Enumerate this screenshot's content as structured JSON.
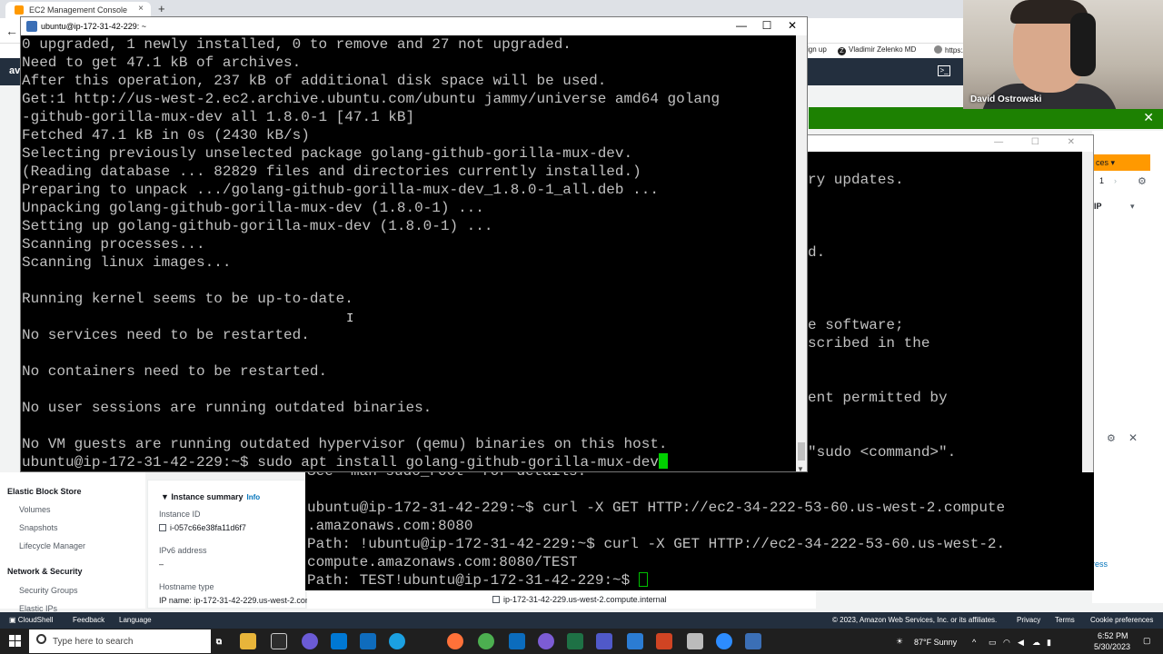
{
  "browser": {
    "tab_title": "EC2 Management Console",
    "tab_close": "×",
    "new_tab": "+",
    "back": "←",
    "bookmarks": [
      "ign up",
      "Vladimir Zelenko MD",
      "https://"
    ]
  },
  "aws": {
    "logo_partial": "av",
    "sidebar": {
      "group_ebs": "Elastic Block Store",
      "ebs_items": [
        "Volumes",
        "Snapshots",
        "Lifecycle Manager"
      ],
      "group_network": "Network & Security",
      "network_items": [
        "Security Groups",
        "Elastic IPs"
      ]
    },
    "summary": {
      "title": "Instance summary",
      "info": "Info",
      "instance_id_label": "Instance ID",
      "instance_id": "i-057c66e38fa11d6f7",
      "ipv6_label": "IPv6 address",
      "ipv6_value": "–",
      "hostname_label": "Hostname type",
      "ip_name": "IP name: ip-172-31-42-229.us-west-2.compute.internal",
      "private_dns": "ip-172-31-42-229.us-west-2.compute.internal"
    },
    "right_panel": {
      "actions": "ces",
      "page": "1",
      "ip_col": "IP",
      "ress": "ress"
    },
    "footer": {
      "cloudshell": "CloudShell",
      "feedback": "Feedback",
      "language": "Language",
      "copyright": "© 2023, Amazon Web Services, Inc. or its affiliates.",
      "privacy": "Privacy",
      "terms": "Terms",
      "cookies": "Cookie preferences"
    }
  },
  "front_terminal": {
    "title": "ubuntu@ip-172-31-42-229: ~",
    "controls": {
      "minimize": "—",
      "maximize": "☐",
      "close": "✕"
    },
    "lines": [
      "0 upgraded, 1 newly installed, 0 to remove and 27 not upgraded.",
      "Need to get 47.1 kB of archives.",
      "After this operation, 237 kB of additional disk space will be used.",
      "Get:1 http://us-west-2.ec2.archive.ubuntu.com/ubuntu jammy/universe amd64 golang",
      "-github-gorilla-mux-dev all 1.8.0-1 [47.1 kB]",
      "Fetched 47.1 kB in 0s (2430 kB/s)",
      "Selecting previously unselected package golang-github-gorilla-mux-dev.",
      "(Reading database ... 82829 files and directories currently installed.)",
      "Preparing to unpack .../golang-github-gorilla-mux-dev_1.8.0-1_all.deb ...",
      "Unpacking golang-github-gorilla-mux-dev (1.8.0-1) ...",
      "Setting up golang-github-gorilla-mux-dev (1.8.0-1) ...",
      "Scanning processes...",
      "Scanning linux images...",
      "",
      "Running kernel seems to be up-to-date.",
      "",
      "No services need to be restarted.",
      "",
      "No containers need to be restarted.",
      "",
      "No user sessions are running outdated binaries.",
      "",
      "No VM guests are running outdated hypervisor (qemu) binaries on this host.",
      "ubuntu@ip-172-31-42-229:~$ sudo apt install golang-github-gorilla-mux-dev"
    ]
  },
  "back_terminal": {
    "controls": "— ☐ ✕",
    "lines": [
      {
        "text": "ry updates.",
        "row": 0
      },
      {
        "text": "d.",
        "row": 4
      },
      {
        "text": "e software;",
        "row": 8
      },
      {
        "text": "scribed in the",
        "row": 9
      },
      {
        "text": "ent permitted by",
        "row": 12
      },
      {
        "text": "\"sudo <command>\".",
        "row": 15
      }
    ]
  },
  "bottom_terminal": {
    "lines": [
      "See \"man sudo_root\" for details.",
      "",
      "ubuntu@ip-172-31-42-229:~$ curl -X GET HTTP://ec2-34-222-53-60.us-west-2.compute",
      ".amazonaws.com:8080",
      "Path: !ubuntu@ip-172-31-42-229:~$ curl -X GET HTTP://ec2-34-222-53-60.us-west-2.",
      "compute.amazonaws.com:8080/TEST",
      "Path: TEST!ubuntu@ip-172-31-42-229:~$ "
    ]
  },
  "webcam": {
    "name": "David Ostrowski"
  },
  "taskbar": {
    "search_placeholder": "Type here to search",
    "weather": "87°F  Sunny",
    "time": "6:52 PM",
    "date": "5/30/2023"
  }
}
